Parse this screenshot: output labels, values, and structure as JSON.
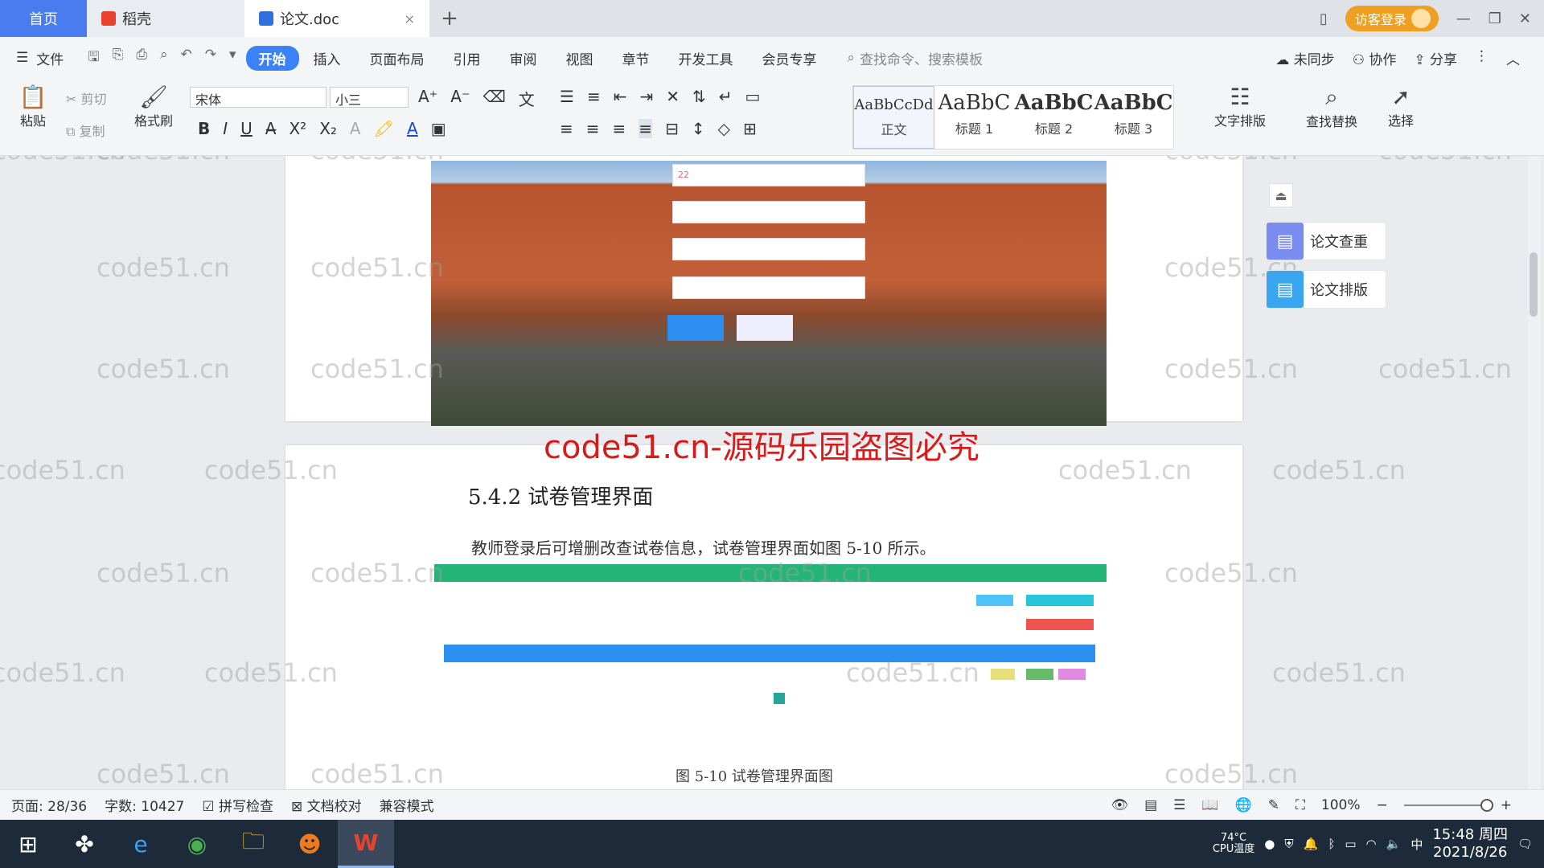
{
  "tabs": [
    {
      "label": "首页"
    },
    {
      "label": "稻壳"
    },
    {
      "label": "论文.doc"
    }
  ],
  "titlebar": {
    "login_label": "访客登录"
  },
  "menu": {
    "items": [
      "文件",
      "开始",
      "插入",
      "页面布局",
      "引用",
      "审阅",
      "视图",
      "章节",
      "开发工具",
      "会员专享"
    ],
    "search_placeholder": "查找命令、搜索模板",
    "right": [
      "未同步",
      "协作",
      "分享"
    ]
  },
  "ribbon": {
    "paste": "粘贴",
    "cut": "剪切",
    "copy": "复制",
    "format_painter": "格式刷",
    "font": "宋体",
    "size": "小三",
    "styles": [
      {
        "preview": "AaBbCcDd",
        "name": "正文"
      },
      {
        "preview": "AaBbC",
        "name": "标题 1"
      },
      {
        "preview": "AaBbC",
        "name": "标题 2"
      },
      {
        "preview": "AaBbC",
        "name": "标题 3"
      }
    ],
    "text_layout": "文字排版",
    "find_replace": "查找替换",
    "select": "选择"
  },
  "document": {
    "watermark": "code51.cn-源码乐园盗图必究",
    "section_title": "5.4.2  试卷管理界面",
    "body_text": "教师登录后可增删改查试卷信息，试卷管理界面如图 5-10 所示。",
    "caption": "图 5-10  试卷管理界面图",
    "login_field_values": [
      "22"
    ],
    "bg_watermark": "code51.cn"
  },
  "sidepanel": {
    "items": [
      "论文查重",
      "论文排版"
    ]
  },
  "statusbar": {
    "page": "页面: 28/36",
    "words": "字数: 10427",
    "spell": "拼写检查",
    "doc_check": "文档校对",
    "compat": "兼容模式",
    "zoom": "100%"
  },
  "taskbar": {
    "cpu_temp": "74°C",
    "cpu_label": "CPU温度",
    "ime": "中",
    "time": "15:48 周四",
    "date": "2021/8/26"
  }
}
